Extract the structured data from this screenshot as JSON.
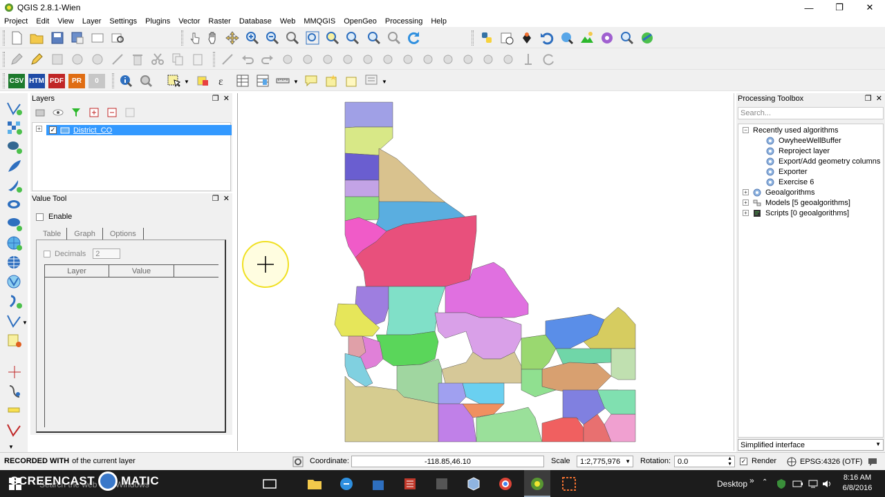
{
  "window": {
    "title": "QGIS 2.8.1-Wien",
    "minimize": "—",
    "maximize": "❐",
    "close": "✕"
  },
  "menu": [
    "Project",
    "Edit",
    "View",
    "Layer",
    "Settings",
    "Plugins",
    "Vector",
    "Raster",
    "Database",
    "Web",
    "MMQGIS",
    "OpenGeo",
    "Processing",
    "Help"
  ],
  "export_buttons": [
    {
      "label": "CSV",
      "color": "#1d7a2d"
    },
    {
      "label": "HTM",
      "color": "#1f4ba6"
    },
    {
      "label": "PDF",
      "color": "#c02626"
    },
    {
      "label": "PR",
      "color": "#e06d12"
    },
    {
      "label": "0",
      "color": "#c7c7c7"
    }
  ],
  "layers_panel": {
    "title": "Layers",
    "layer_name": "District_CO"
  },
  "value_tool": {
    "title": "Value Tool",
    "enable_label": "Enable",
    "tabs": [
      "Table",
      "Graph",
      "Options"
    ],
    "decimals_label": "Decimals",
    "decimals_value": "2",
    "columns": [
      "Layer",
      "Value"
    ]
  },
  "processing": {
    "title": "Processing Toolbox",
    "search_placeholder": "Search...",
    "recent_group": "Recently used algorithms",
    "recent_items": [
      "OwyheeWellBuffer",
      "Reproject layer",
      "Export/Add geometry columns",
      "Exporter",
      "Exercise 6"
    ],
    "groups": [
      "Geoalgorithms",
      "Models [5 geoalgorithms]",
      "Scripts [0 geoalgorithms]"
    ],
    "interface_mode": "Simplified interface"
  },
  "statusbar": {
    "message": "of the current layer",
    "watermark": "RECORDED WITH",
    "coordinate_label": "Coordinate:",
    "coordinate_value": "-118.85,46.10",
    "scale_label": "Scale",
    "scale_value": "1:2,775,976",
    "rotation_label": "Rotation:",
    "rotation_value": "0.0",
    "render_label": "Render",
    "crs": "EPSG:4326 (OTF)"
  },
  "taskbar": {
    "search_text": "Search the web and Windows",
    "brand": "SCREENCAST",
    "brand2": "MATIC",
    "desktop_label": "Desktop",
    "time": "8:16 AM",
    "date": "6/8/2016",
    "overflow": "»"
  },
  "colors": {
    "selection": "#3399ff",
    "panel_bg": "#f0f0f0",
    "cursor_highlight": "#ffff3c"
  },
  "map_regions": [
    {
      "name": "region-01",
      "fill": "#a0a0e6"
    },
    {
      "name": "region-02",
      "fill": "#d8e887"
    },
    {
      "name": "region-03",
      "fill": "#6a5ed0"
    },
    {
      "name": "region-04",
      "fill": "#c3a3e6"
    },
    {
      "name": "region-05",
      "fill": "#d9c28e"
    },
    {
      "name": "region-06",
      "fill": "#8ee07e"
    },
    {
      "name": "region-07",
      "fill": "#f05bc8"
    },
    {
      "name": "region-08",
      "fill": "#5aaee0"
    },
    {
      "name": "region-09",
      "fill": "#e8507c"
    },
    {
      "name": "region-10",
      "fill": "#9e7ee0"
    },
    {
      "name": "region-11",
      "fill": "#e6e65a"
    },
    {
      "name": "region-12",
      "fill": "#80e0c8"
    },
    {
      "name": "region-13",
      "fill": "#e070e0"
    },
    {
      "name": "region-14",
      "fill": "#d9a0e8"
    },
    {
      "name": "region-15",
      "fill": "#5ad65a"
    },
    {
      "name": "region-16",
      "fill": "#e080d8"
    },
    {
      "name": "region-17",
      "fill": "#e0a0a8"
    },
    {
      "name": "region-18",
      "fill": "#80d0e0"
    },
    {
      "name": "region-19",
      "fill": "#d6cc90"
    },
    {
      "name": "region-20",
      "fill": "#a0d6a0"
    },
    {
      "name": "region-21",
      "fill": "#5a8ee8"
    },
    {
      "name": "region-22",
      "fill": "#d6cc60"
    },
    {
      "name": "region-23",
      "fill": "#9ad870"
    },
    {
      "name": "region-24",
      "fill": "#70d6a8"
    },
    {
      "name": "region-25",
      "fill": "#d8a070"
    },
    {
      "name": "region-26",
      "fill": "#c0e0b0"
    },
    {
      "name": "region-27",
      "fill": "#90e090"
    },
    {
      "name": "region-28",
      "fill": "#d6c898"
    },
    {
      "name": "region-29",
      "fill": "#a0a0f0"
    },
    {
      "name": "region-30",
      "fill": "#6ad0f0"
    },
    {
      "name": "region-31",
      "fill": "#f09060"
    },
    {
      "name": "region-32",
      "fill": "#c080e8"
    },
    {
      "name": "region-33",
      "fill": "#9ae09a"
    },
    {
      "name": "region-34",
      "fill": "#f06060"
    },
    {
      "name": "region-35",
      "fill": "#8080e0"
    },
    {
      "name": "region-36",
      "fill": "#e87070"
    },
    {
      "name": "region-37",
      "fill": "#f0a0d0"
    },
    {
      "name": "region-38",
      "fill": "#80e0b0"
    }
  ]
}
